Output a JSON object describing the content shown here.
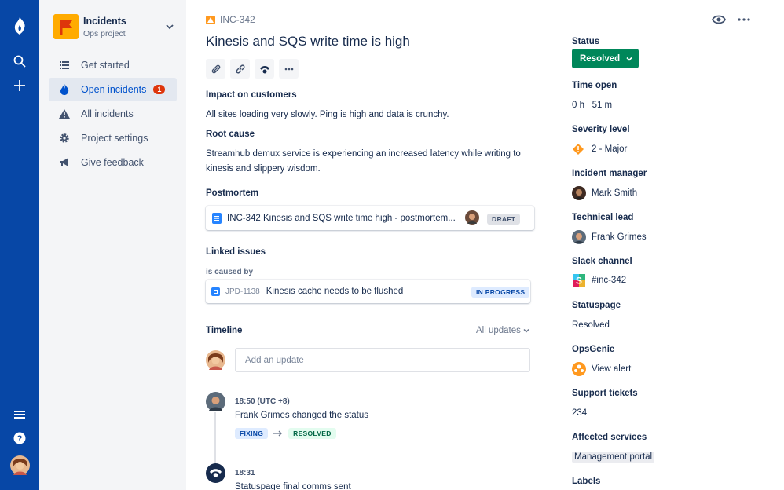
{
  "project": {
    "name": "Incidents",
    "subtitle": "Ops project"
  },
  "sidebar": {
    "items": [
      {
        "label": "Get started",
        "icon": "list-icon"
      },
      {
        "label": "Open incidents",
        "icon": "fire-icon",
        "badge": "1",
        "active": true
      },
      {
        "label": "All incidents",
        "icon": "alert-triangle-icon"
      },
      {
        "label": "Project settings",
        "icon": "gear-icon"
      },
      {
        "label": "Give feedback",
        "icon": "megaphone-icon"
      }
    ]
  },
  "issue": {
    "key": "INC-342",
    "title": "Kinesis and SQS write time is high"
  },
  "sections": {
    "impact_heading": "Impact on customers",
    "impact_text": "All sites loading very slowly. Ping is high and data is crunchy.",
    "root_heading": "Root cause",
    "root_text": "Streamhub demux service is experiencing an increased latency while writing to kinesis and slippery wisdom.",
    "postmortem_heading": "Postmortem",
    "postmortem_title": "INC-342 Kinesis and SQS write time high - postmortem...",
    "postmortem_status": "DRAFT",
    "linked_heading": "Linked issues",
    "linked_relation": "is caused by",
    "linked_key": "JPD-1138",
    "linked_title": "Kinesis cache needs to be flushed",
    "linked_status": "IN PROGRESS"
  },
  "timeline": {
    "heading": "Timeline",
    "filter": "All updates",
    "placeholder": "Add an update",
    "entries": [
      {
        "time": "18:50 (UTC +8)",
        "text": "Frank Grimes changed the status",
        "from": "FIXING",
        "to": "RESOLVED"
      },
      {
        "time": "18:31",
        "text": "Statuspage final comms sent"
      }
    ]
  },
  "details": {
    "status_label": "Status",
    "status_value": "Resolved",
    "time_open_label": "Time open",
    "time_open_value": "0 h   51 m",
    "severity_label": "Severity level",
    "severity_value": "2 - Major",
    "manager_label": "Incident manager",
    "manager_value": "Mark Smith",
    "lead_label": "Technical lead",
    "lead_value": "Frank Grimes",
    "slack_label": "Slack channel",
    "slack_value": "#inc-342",
    "statuspage_label": "Statuspage",
    "statuspage_value": "Resolved",
    "opsgenie_label": "OpsGenie",
    "opsgenie_value": "View alert",
    "support_label": "Support tickets",
    "support_value": "234",
    "services_label": "Affected services",
    "services_value": "Management portal",
    "labels_label": "Labels"
  },
  "colors": {
    "nav": "#0747A6",
    "accent": "#0052CC",
    "success": "#00875A",
    "danger": "#DE350B",
    "warning": "#FFAB00"
  }
}
